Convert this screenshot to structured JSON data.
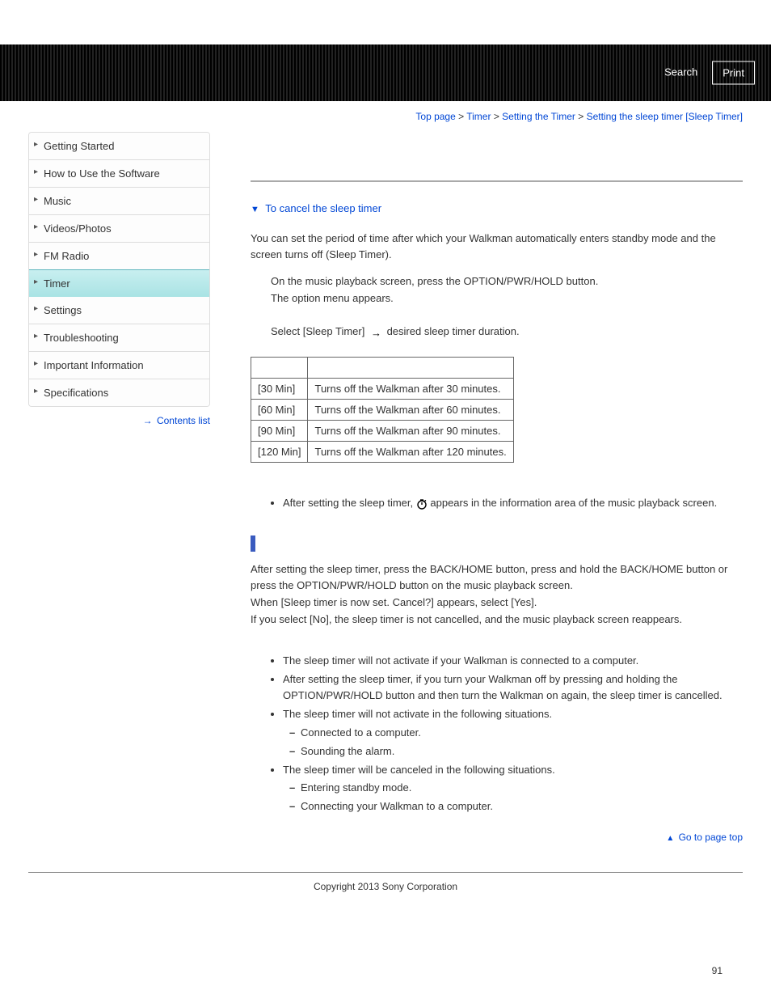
{
  "header": {
    "search_label": "Search",
    "print_label": "Print"
  },
  "breadcrumb": {
    "top": "Top page",
    "l1": "Timer",
    "l2": "Setting the Timer",
    "current": "Setting the sleep timer [Sleep Timer]"
  },
  "sidebar": {
    "items": [
      "Getting Started",
      "How to Use the Software",
      "Music",
      "Videos/Photos",
      "FM Radio",
      "Timer",
      "Settings",
      "Troubleshooting",
      "Important Information",
      "Specifications"
    ],
    "active_index": 5,
    "contents_list": "Contents list"
  },
  "content": {
    "jump_link": "To cancel the sleep timer",
    "intro": "You can set the period of time after which your Walkman automatically enters standby mode and the screen turns off (Sleep Timer).",
    "step1a": "On the music playback screen, press the OPTION/PWR/HOLD button.",
    "step1b": "The option menu appears.",
    "step2_pre": "Select [Sleep Timer]",
    "step2_post": "  desired sleep timer duration.",
    "table": [
      {
        "label": "[30 Min]",
        "desc": "Turns off the Walkman after 30 minutes."
      },
      {
        "label": "[60 Min]",
        "desc": "Turns off the Walkman after 60 minutes."
      },
      {
        "label": "[90 Min]",
        "desc": "Turns off the Walkman after 90 minutes."
      },
      {
        "label": "[120 Min]",
        "desc": "Turns off the Walkman after 120 minutes."
      }
    ],
    "hint_pre": "After setting the sleep timer, ",
    "hint_post": " appears in the information area of the music playback screen.",
    "cancel": {
      "p1": "After setting the sleep timer, press the BACK/HOME button, press and hold the BACK/HOME button or press the OPTION/PWR/HOLD button on the music playback screen.",
      "p2": "When [Sleep timer is now set. Cancel?] appears, select [Yes].",
      "p3": "If you select [No], the sleep timer is not cancelled, and the music playback screen reappears."
    },
    "notes": {
      "n1": "The sleep timer will not activate if your Walkman is connected to a computer.",
      "n2": "After setting the sleep timer, if you turn your Walkman off by pressing and holding the OPTION/PWR/HOLD button and then turn the Walkman on again, the sleep timer is cancelled.",
      "n3": "The sleep timer will not activate in the following situations.",
      "n3a": "Connected to a computer.",
      "n3b": "Sounding the alarm.",
      "n4": "The sleep timer will be canceled in the following situations.",
      "n4a": "Entering standby mode.",
      "n4b": "Connecting your Walkman to a computer."
    },
    "go_top": "Go to page top"
  },
  "footer": {
    "copyright": "Copyright 2013 Sony Corporation",
    "page_number": "91"
  }
}
